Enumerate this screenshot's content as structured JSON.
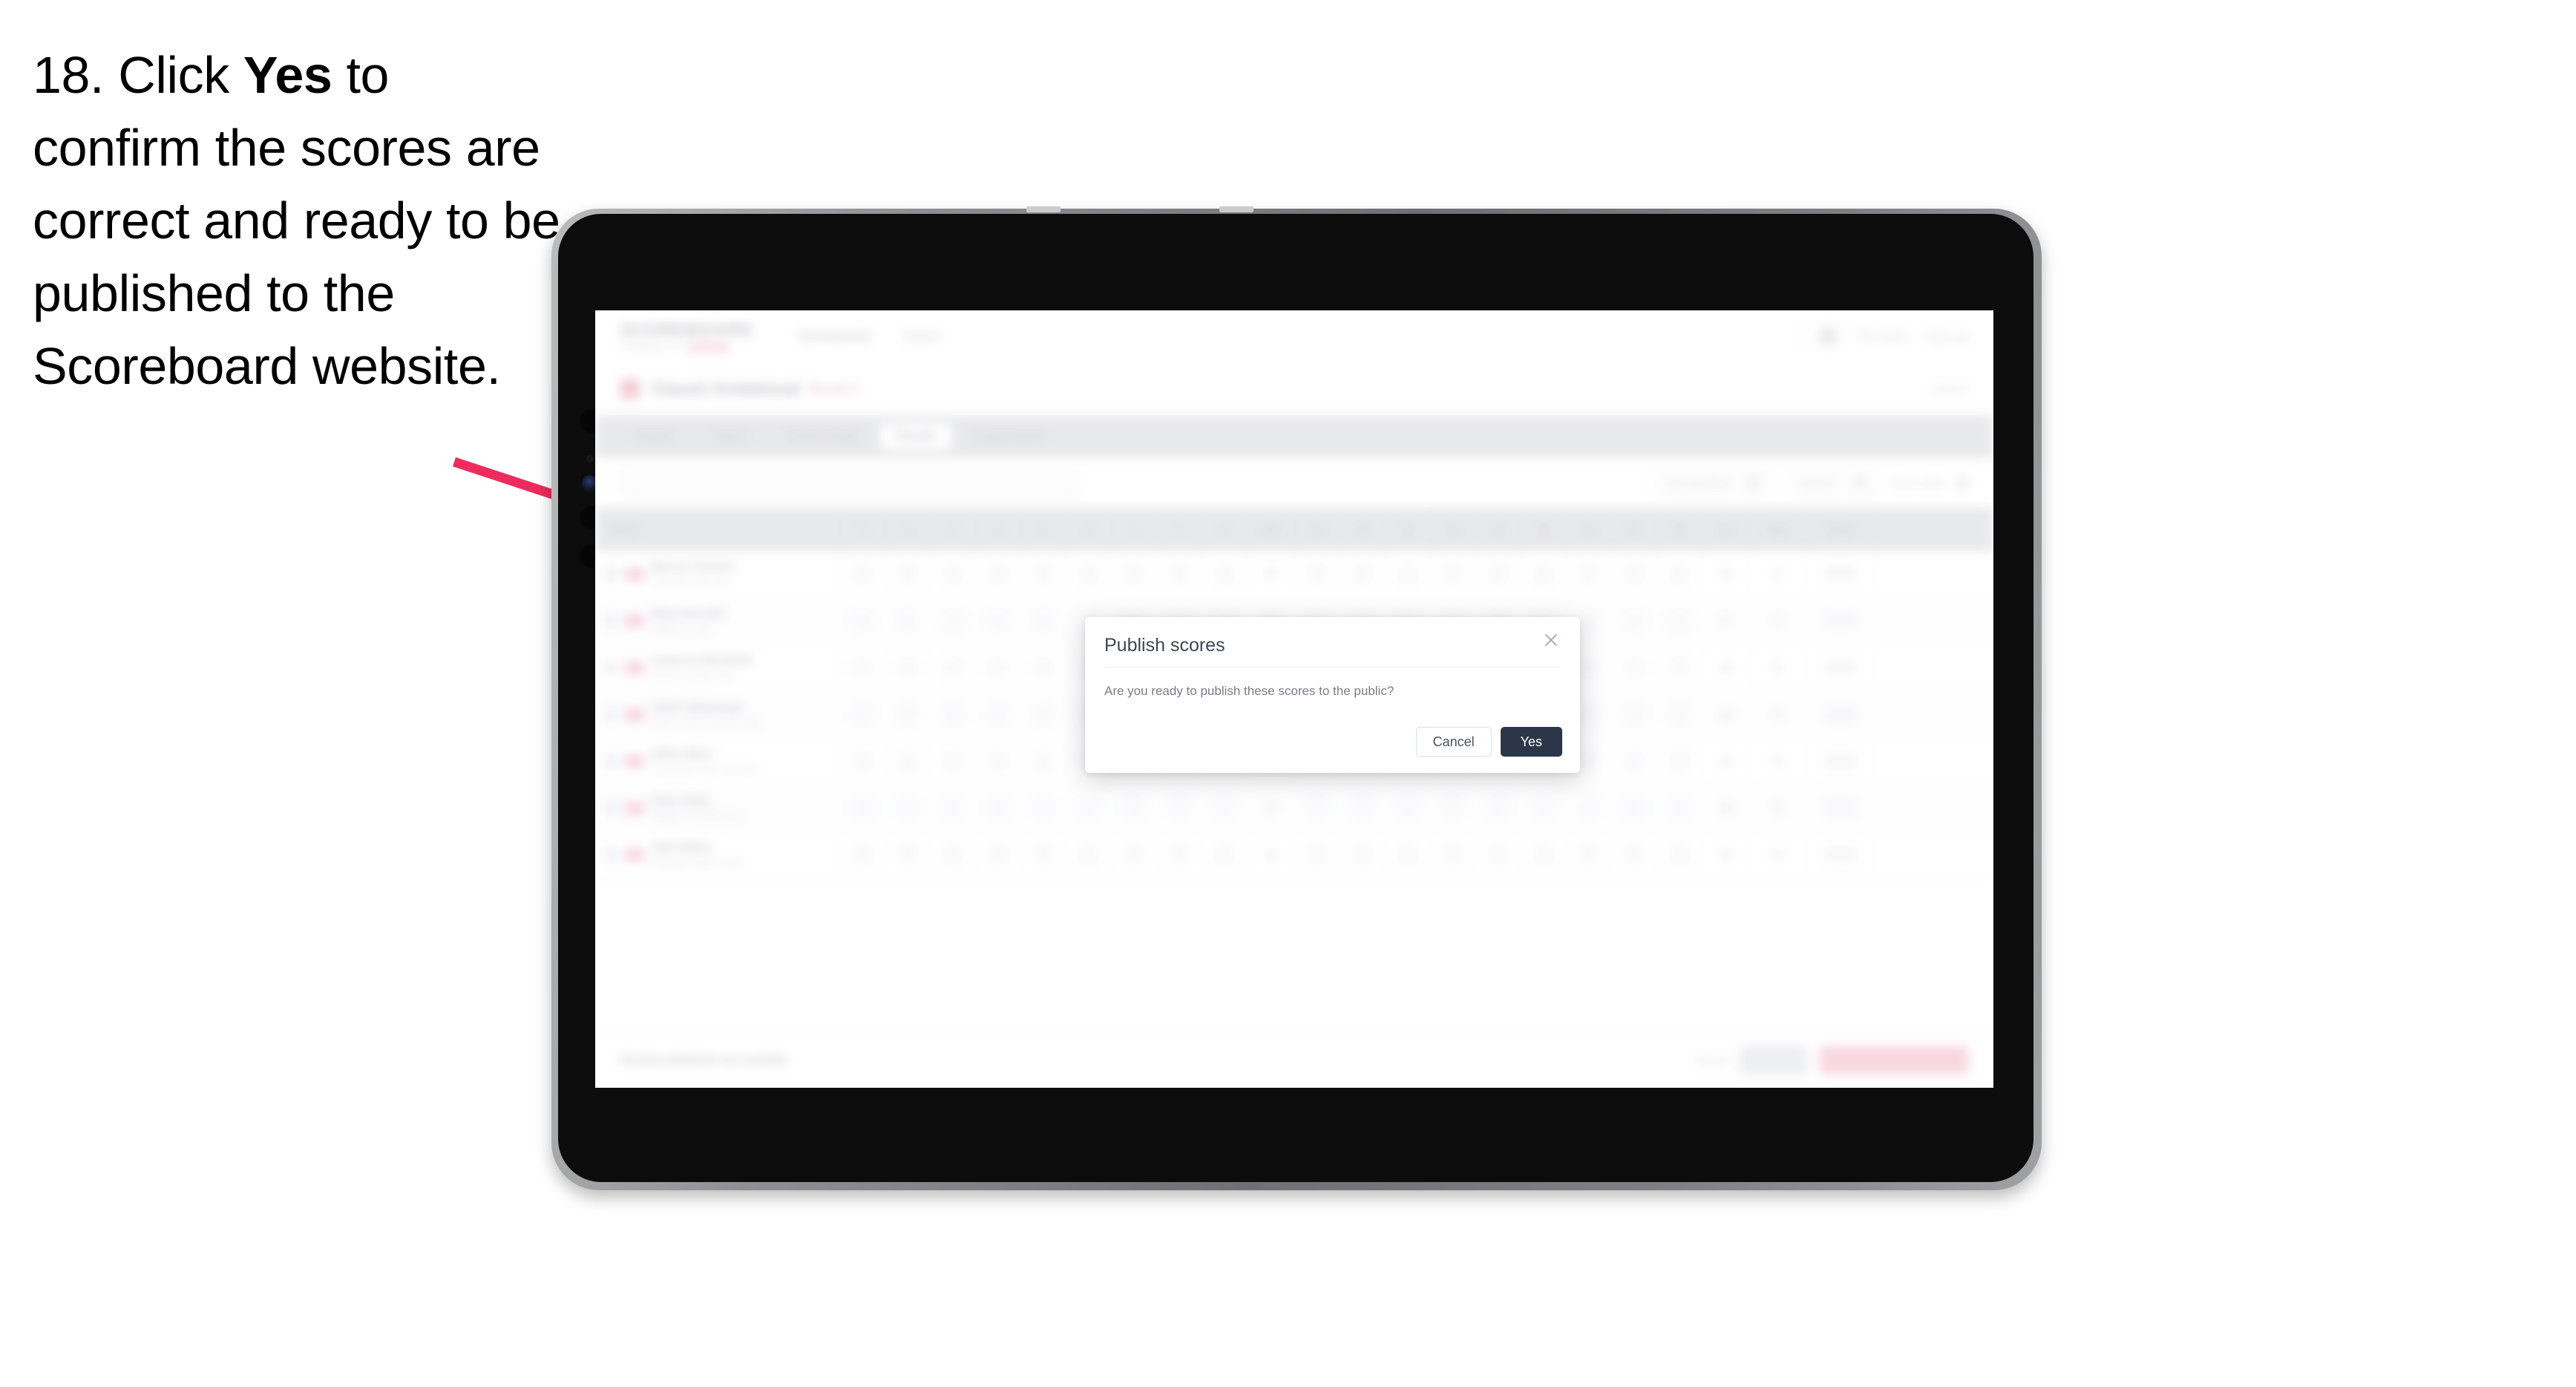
{
  "instruction": {
    "number": "18.",
    "part1": "Click ",
    "emphasis": "Yes",
    "part2": " to confirm the scores are correct and ready to be published to the Scoreboard website."
  },
  "annotation": {
    "arrow_color": "#EE2B5E",
    "arrow_name": "pointer-arrow"
  },
  "device": {
    "type": "tablet",
    "body_color": "#0c0c0c",
    "rim_color": "#8e9093"
  },
  "app": {
    "brand": {
      "name": "SCOREBOARD",
      "subtitle": "POWERED BY",
      "badge": "GOLF"
    },
    "nav": [
      {
        "label": "Tournaments",
        "active": true
      },
      {
        "label": "Teams",
        "active": false
      }
    ],
    "header_right": {
      "user": "Tom Quinn",
      "signout": "Sign out"
    },
    "event": {
      "title": "Classic Invitational",
      "round": "Round 1",
      "right": "Level 3"
    },
    "tabs": [
      {
        "label": "Details",
        "active": false
      },
      {
        "label": "Teams",
        "active": false
      },
      {
        "label": "Course Setup",
        "active": false
      },
      {
        "label": "Results",
        "active": true
      },
      {
        "label": "Leaderboard",
        "active": false
      }
    ],
    "toolbar": {
      "search_placeholder": "Search players",
      "filter_tee": "Filter by player",
      "filter_round": "Round 1",
      "filter_sort": "Score order"
    },
    "table": {
      "columns": [
        "Player",
        "1",
        "2",
        "3",
        "4",
        "5",
        "6",
        "7",
        "8",
        "9",
        "OUT",
        "10",
        "11",
        "12",
        "13",
        "14",
        "15",
        "16",
        "17",
        "18",
        "IN",
        "Total",
        "Status"
      ],
      "rows": [
        {
          "name": "Marcus Torrens",
          "club": "Pinehurst Golf Club",
          "out": "36",
          "in": "35",
          "total": "71",
          "status": "Final"
        },
        {
          "name": "Rhys Donnell",
          "club": "Oakmont Links",
          "out": "35",
          "in": "37",
          "total": "72",
          "status": "Final"
        },
        {
          "name": "Cameron Beckwith",
          "club": "Riviera Country Club",
          "out": "37",
          "in": "36",
          "total": "73",
          "status": "Final"
        },
        {
          "name": "Oliver Mataranga",
          "club": "Merion Golf & Country Club",
          "out": "36",
          "in": "38",
          "total": "74",
          "status": "Final"
        },
        {
          "name": "Ethan Wren",
          "club": "Shinnecock Hills Golf Club",
          "out": "38",
          "in": "36",
          "total": "74",
          "status": "Final"
        },
        {
          "name": "Ryan Kirby",
          "club": "Winged Foot Golf Club",
          "out": "37",
          "in": "38",
          "total": "75",
          "status": "Final"
        },
        {
          "name": "Nate Bailey",
          "club": "Bethpage Black Course",
          "out": "38",
          "in": "38",
          "total": "76",
          "status": "Final"
        }
      ]
    },
    "bottom_bar": {
      "note": "Results published successfully",
      "link": "Cancel",
      "secondary_button": "Save all",
      "primary_button": "Publish results to public"
    }
  },
  "dialog": {
    "title": "Publish scores",
    "body": "Are you ready to publish these scores to the public?",
    "cancel_label": "Cancel",
    "confirm_label": "Yes",
    "close_icon": "close-icon",
    "confirm_color": "#2b3648"
  }
}
